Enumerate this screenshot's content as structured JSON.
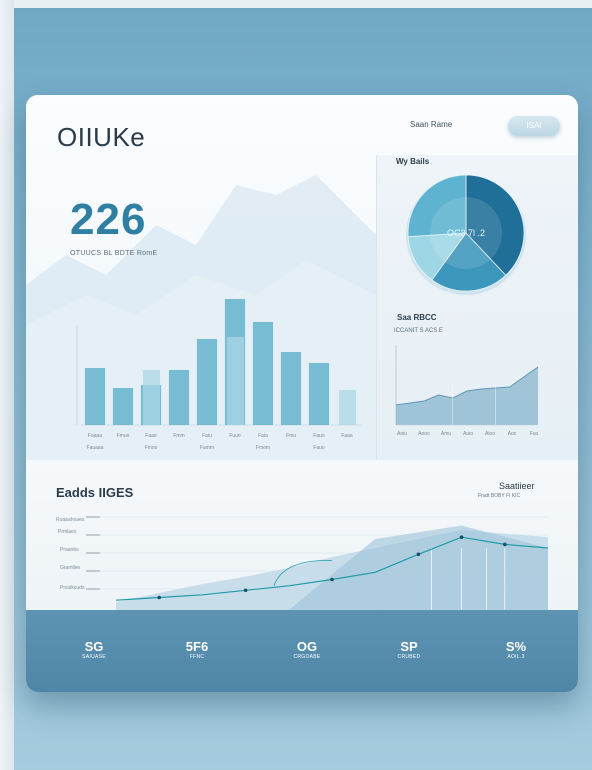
{
  "header": {
    "logo": "OIIUKe",
    "search_label": "Saan Rame",
    "search_button": "ISAI"
  },
  "kpi": {
    "value": "226",
    "subtitle": "OTUUCS  BL  BDTE RomE"
  },
  "pie_panel": {
    "label": "Wy Bails",
    "center_label": "OC3  7l .2"
  },
  "line_panel": {
    "label": "Saa  RBCC",
    "sublabel": "ICCANIT  S  ACS E"
  },
  "lower": {
    "title": "Eadds IIGES",
    "right_title": "Saatiieer",
    "right_sub": "Fnatt  BOBY  FI  KIC",
    "ylabels": [
      "Ruaaahoaes",
      "Prmlaes",
      "Praanbs",
      "Gramllee",
      "Prsulkcuds"
    ]
  },
  "footer": {
    "stats": [
      {
        "value": "SG",
        "label": "SAIUASE"
      },
      {
        "value": "5F6",
        "label": "FFNC"
      },
      {
        "value": "OG",
        "label": "CRGOABE"
      },
      {
        "value": "SP",
        "label": "CRUBED"
      },
      {
        "value": "S%",
        "label": "AOIL.3"
      }
    ]
  },
  "chart_data": [
    {
      "type": "bar",
      "title": "",
      "categories": [
        "1",
        "2",
        "3",
        "4",
        "5",
        "6",
        "7",
        "8",
        "9",
        "10"
      ],
      "series": [
        {
          "values": [
            57,
            37,
            40,
            55,
            86,
            126,
            103,
            73,
            62,
            0
          ]
        },
        {
          "values": [
            0,
            0,
            55,
            0,
            0,
            88,
            0,
            0,
            0,
            35
          ]
        }
      ],
      "ylim": [
        0,
        140
      ],
      "xtick_labels": [
        "Faaaa",
        "Fmuo",
        "Faao",
        "Fmm",
        "Faiu",
        "Fuuo",
        "Faia",
        "Fmu",
        "Fauo",
        "Faaa"
      ],
      "xtick_labels_2": [
        "Fauaaa",
        "Fmoo",
        "Famm",
        "Fmom",
        "Fauo"
      ],
      "colors": [
        "#6ab6cf",
        "#a9d8e6"
      ]
    },
    {
      "type": "pie",
      "title": "",
      "values": [
        38,
        22,
        14,
        26
      ],
      "colors": [
        "#1f6f98",
        "#3d97bd",
        "#9ed6e5",
        "#5db3d0"
      ]
    },
    {
      "type": "area",
      "title": "",
      "x": [
        0,
        1,
        2,
        3,
        4,
        5,
        6,
        7,
        8,
        9,
        10
      ],
      "values": [
        20,
        22,
        24,
        30,
        27,
        34,
        36,
        37,
        38,
        48,
        58
      ],
      "ylim": [
        0,
        80
      ],
      "xtick_labels": [
        "Aoiu",
        "Aooo",
        "Amu",
        "Auio",
        "Aioo",
        "Aoc",
        "Fuo"
      ]
    },
    {
      "type": "line",
      "title": "",
      "x": [
        0,
        1,
        2,
        3,
        4,
        5,
        6,
        7,
        8,
        9,
        10
      ],
      "values": [
        2,
        5,
        8,
        13,
        18,
        25,
        33,
        53,
        72,
        64,
        60
      ],
      "area_values": [
        0,
        10,
        20,
        28,
        38,
        50,
        60,
        70,
        80,
        76,
        72
      ],
      "ylim": [
        0,
        100
      ]
    }
  ]
}
